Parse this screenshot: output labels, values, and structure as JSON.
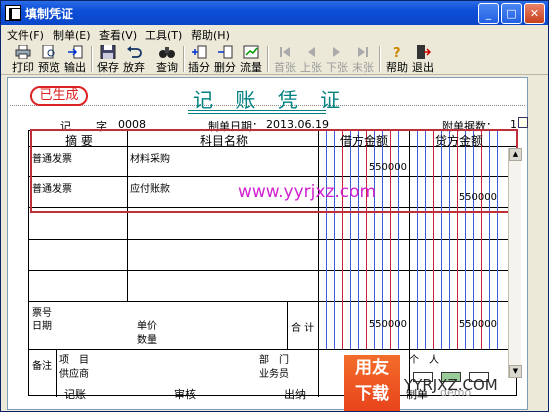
{
  "window": {
    "title": "填制凭证"
  },
  "menu": [
    "文件(F)",
    "制单(E)",
    "查看(V)",
    "工具(T)",
    "帮助(H)"
  ],
  "toolbar": [
    {
      "label": "打印",
      "icon": "printer-icon",
      "enabled": true
    },
    {
      "label": "预览",
      "icon": "preview-icon",
      "enabled": true
    },
    {
      "label": "输出",
      "icon": "export-icon",
      "enabled": true
    },
    {
      "label": "保存",
      "icon": "save-icon",
      "enabled": true
    },
    {
      "label": "放弃",
      "icon": "undo-icon",
      "enabled": true
    },
    {
      "label": "查询",
      "icon": "binoculars-icon",
      "enabled": true
    },
    {
      "label": "插分",
      "icon": "insert-row-icon",
      "enabled": true
    },
    {
      "label": "删分",
      "icon": "delete-row-icon",
      "enabled": true
    },
    {
      "label": "流量",
      "icon": "cashflow-icon",
      "enabled": true
    },
    {
      "label": "首张",
      "icon": "first-icon",
      "enabled": false
    },
    {
      "label": "上张",
      "icon": "prev-icon",
      "enabled": false
    },
    {
      "label": "下张",
      "icon": "next-icon",
      "enabled": false
    },
    {
      "label": "末张",
      "icon": "last-icon",
      "enabled": false
    },
    {
      "label": "帮助",
      "icon": "help-icon",
      "enabled": true
    },
    {
      "label": "退出",
      "icon": "exit-icon",
      "enabled": true
    }
  ],
  "voucher": {
    "status": "已生成",
    "title": "记 账 凭 证",
    "type_label": "记",
    "number_label": "字",
    "number": "0008",
    "date_label": "制单日期：",
    "date": "2013.06.19",
    "attachments_label": "附单据数：",
    "attachments": "1",
    "headers": {
      "summary": "摘 要",
      "account": "科目名称",
      "debit": "借方金额",
      "credit": "贷方金额"
    },
    "rows": [
      {
        "summary": "普通发票",
        "account": "材料采购",
        "debit": "550000",
        "credit": ""
      },
      {
        "summary": "普通发票",
        "account": "应付账款",
        "debit": "",
        "credit": "550000"
      }
    ],
    "watermark": "www.yyrjxz.com",
    "footer": {
      "ticket_no": "票号",
      "date": "日期",
      "unit_price": "单价",
      "quantity": "数量",
      "total": "合 计",
      "debit_total": "550000",
      "credit_total": "550000",
      "remark": "备注",
      "project": "项　目",
      "supplier": "供应商",
      "department": "部　门",
      "salesperson": "业务员",
      "person": "个　人"
    },
    "signatures": {
      "bookkeeping": "记账",
      "review": "审核",
      "cashier": "出纳",
      "maker": "制单",
      "maker_name": "demo"
    }
  },
  "branding": {
    "logo_text_1": "用友",
    "logo_text_2": "下载",
    "site": "YYRJXZ.COM"
  }
}
